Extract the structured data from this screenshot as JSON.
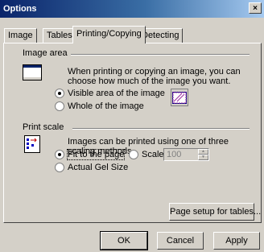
{
  "window": {
    "title": "Options",
    "close": "×"
  },
  "tabs": [
    {
      "label": "Image",
      "active": false
    },
    {
      "label": "Tables",
      "active": false
    },
    {
      "label": "Printing/Copying",
      "active": true
    },
    {
      "label": "Detecting",
      "active": false
    }
  ],
  "image_area": {
    "title": "Image area",
    "description": "When printing or copying an image, you can choose how much of the image you want.",
    "options": [
      {
        "label": "Visible area of the image",
        "checked": true
      },
      {
        "label": "Whole of the image",
        "checked": false
      }
    ]
  },
  "print_scale": {
    "title": "Print scale",
    "description": "Images can be printed using one of three scaling methods.",
    "fit": {
      "label": "Fit to the page",
      "checked": true
    },
    "scaled": {
      "label": "Scaled",
      "checked": false,
      "value": "100"
    },
    "actual": {
      "label": "Actual Gel Size",
      "checked": false
    }
  },
  "page_setup_button": "Page setup for tables...",
  "buttons": {
    "ok": "OK",
    "cancel": "Cancel",
    "apply": "Apply"
  }
}
